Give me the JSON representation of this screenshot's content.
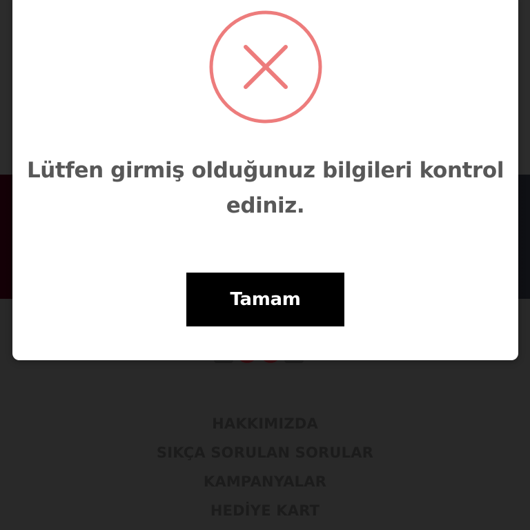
{
  "background": {
    "footer_links": [
      {
        "label": "HAKKIMIZDA"
      },
      {
        "label": "SIKÇA SORULAN SORULAR"
      },
      {
        "label": "KAMPANYALAR"
      },
      {
        "label": "HEDİYE KART"
      }
    ]
  },
  "dialog": {
    "icon": "error-x-circle-icon",
    "icon_color": "#ed7c7c",
    "message": "Lütfen girmiş olduğunuz bilgileri kontrol ediniz.",
    "confirm_label": "Tamam"
  }
}
